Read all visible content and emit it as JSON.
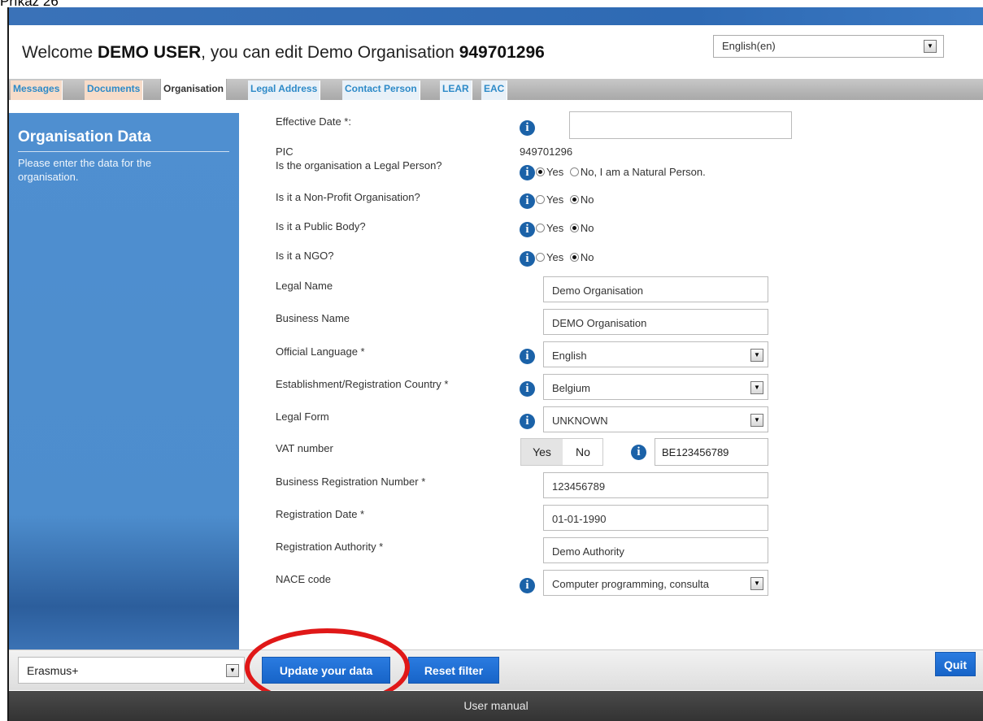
{
  "caption": "Příkaz 26",
  "header": {
    "welcome_prefix": "Welcome ",
    "user_name": "DEMO USER",
    "welcome_mid": ", you can edit Demo Organisation ",
    "org_id": "949701296",
    "language": "English(en)"
  },
  "tabs": [
    {
      "label": "Messages"
    },
    {
      "label": "Documents"
    },
    {
      "label": "Organisation"
    },
    {
      "label": "Legal Address"
    },
    {
      "label": "Contact Person"
    },
    {
      "label": "LEAR"
    },
    {
      "label": "EAC"
    }
  ],
  "sidebar": {
    "title": "Organisation Data",
    "description": "Please enter the data for the organisation."
  },
  "form": {
    "effective_date": {
      "label": "Effective Date *:",
      "value": ""
    },
    "pic": {
      "label": "PIC",
      "value": "949701296"
    },
    "legal_person": {
      "label": "Is the organisation a Legal Person?",
      "yes": "Yes",
      "no": "No, I am a Natural Person.",
      "selected": "yes"
    },
    "non_profit": {
      "label": "Is it a Non-Profit Organisation?",
      "yes": "Yes",
      "no": "No",
      "selected": "no"
    },
    "public_body": {
      "label": "Is it a Public Body?",
      "yes": "Yes",
      "no": "No",
      "selected": "no"
    },
    "ngo": {
      "label": "Is it a NGO?",
      "yes": "Yes",
      "no": "No",
      "selected": "no"
    },
    "legal_name": {
      "label": "Legal Name",
      "value": "Demo Organisation"
    },
    "business_name": {
      "label": "Business Name",
      "value": "DEMO Organisation"
    },
    "official_language": {
      "label": "Official Language *",
      "value": "English"
    },
    "country": {
      "label": "Establishment/Registration Country *",
      "value": "Belgium"
    },
    "legal_form": {
      "label": "Legal Form",
      "value": "UNKNOWN"
    },
    "vat": {
      "label": "VAT number",
      "yes": "Yes",
      "no": "No",
      "selected": "yes",
      "value": "BE123456789"
    },
    "business_reg_number": {
      "label": "Business Registration Number *",
      "value": "123456789"
    },
    "registration_date": {
      "label": "Registration Date *",
      "value": "01-01-1990"
    },
    "registration_authority": {
      "label": "Registration Authority *",
      "value": "Demo Authority"
    },
    "nace": {
      "label": "NACE code",
      "value": "Computer programming, consulta"
    }
  },
  "bottom": {
    "programme": "Erasmus+",
    "update_label": "Update your data",
    "reset_label": "Reset filter",
    "quit_label": "Quit"
  },
  "footer": {
    "manual": "User manual"
  },
  "colors": {
    "accent": "#1764c8",
    "sidebar": "#4d8dcd",
    "highlight": "#e01818",
    "tab_link": "#2d8ac8"
  }
}
